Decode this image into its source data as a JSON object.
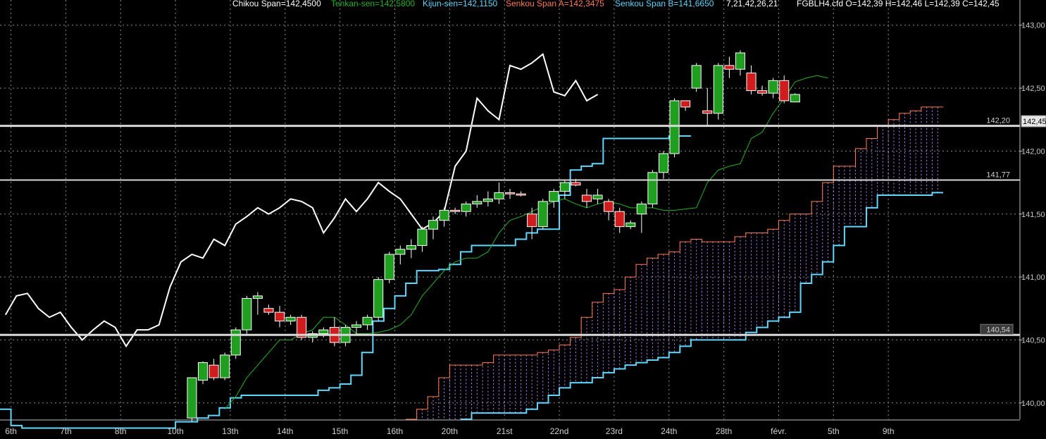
{
  "header": {
    "chikou": "Chikou Span=142,4500",
    "tenkan": "Tenkan-sen=142,5800",
    "kijun": "Kijun-sen=142,1150",
    "senkou_a": "Senkou Span A=142,3475",
    "senkou_b": "Senkou Span B=141,6650",
    "params": "7,21,42,26,21",
    "symbol_ohlc": "FGBLH4.cfd O=142,39 H=142,46 L=142,39 C=142,45"
  },
  "price_tag": "142,45",
  "colors": {
    "background": "#000000",
    "grid": "#8a8a8a",
    "up_candle": "#1f9e1f",
    "down_candle": "#d01c1c",
    "chikou": "#ffffff",
    "tenkan": "#22b422",
    "kijun": "#5fd7ff",
    "senkou_a": "#ff7a55",
    "senkou_b": "#5fd7ff",
    "cloud_fill": "#c080ff",
    "level_line": "#d8d8d8"
  },
  "chart_data": {
    "type": "candlestick",
    "instrument": "FGBLH4.cfd",
    "ylim": [
      139.87,
      143.2
    ],
    "yticks": [
      140.0,
      140.5,
      141.0,
      141.5,
      142.0,
      142.5,
      143.0
    ],
    "ytick_labels": [
      "140,00",
      "140,50",
      "141,00",
      "141,50",
      "142,00",
      "142,50",
      "143,00"
    ],
    "xlim": [
      0,
      93
    ],
    "x_labels": [
      {
        "x": 1,
        "label": "6th"
      },
      {
        "x": 6,
        "label": "7th"
      },
      {
        "x": 11,
        "label": "8th"
      },
      {
        "x": 16,
        "label": "10th"
      },
      {
        "x": 21,
        "label": "13th"
      },
      {
        "x": 26,
        "label": "14th"
      },
      {
        "x": 31,
        "label": "15th"
      },
      {
        "x": 36,
        "label": "16th"
      },
      {
        "x": 41,
        "label": "20th"
      },
      {
        "x": 46,
        "label": "21st"
      },
      {
        "x": 51,
        "label": "22nd"
      },
      {
        "x": 56,
        "label": "23rd"
      },
      {
        "x": 61,
        "label": "24th"
      },
      {
        "x": 66,
        "label": "28th"
      },
      {
        "x": 71,
        "label": "févr."
      },
      {
        "x": 76,
        "label": "5th"
      },
      {
        "x": 81,
        "label": "9th"
      }
    ],
    "levels": [
      {
        "value": 142.2,
        "label": "142,20"
      },
      {
        "value": 141.77,
        "label": "141,77"
      },
      {
        "value": 140.54,
        "label": "140,54"
      }
    ],
    "candles_start_x": 17,
    "candles": [
      [
        139.88,
        140.2,
        139.85,
        140.2
      ],
      [
        140.18,
        140.33,
        140.15,
        140.32
      ],
      [
        140.3,
        140.35,
        140.18,
        140.2
      ],
      [
        140.2,
        140.4,
        140.18,
        140.38
      ],
      [
        140.38,
        140.6,
        140.35,
        140.58
      ],
      [
        140.58,
        140.85,
        140.55,
        140.83
      ],
      [
        140.83,
        140.88,
        140.7,
        140.85
      ],
      [
        140.75,
        140.78,
        140.7,
        140.72
      ],
      [
        140.72,
        140.77,
        140.6,
        140.65
      ],
      [
        140.65,
        140.7,
        140.62,
        140.68
      ],
      [
        140.68,
        140.7,
        140.5,
        140.52
      ],
      [
        140.52,
        140.57,
        140.48,
        140.55
      ],
      [
        140.55,
        140.6,
        140.52,
        140.58
      ],
      [
        140.6,
        140.68,
        140.45,
        140.48
      ],
      [
        140.48,
        140.62,
        140.45,
        140.6
      ],
      [
        140.6,
        140.65,
        140.55,
        140.62
      ],
      [
        140.62,
        140.7,
        140.58,
        140.68
      ],
      [
        140.68,
        141.0,
        140.65,
        140.98
      ],
      [
        140.98,
        141.2,
        140.95,
        141.18
      ],
      [
        141.18,
        141.25,
        141.1,
        141.22
      ],
      [
        141.22,
        141.3,
        141.15,
        141.25
      ],
      [
        141.25,
        141.4,
        141.2,
        141.38
      ],
      [
        141.38,
        141.48,
        141.3,
        141.45
      ],
      [
        141.45,
        141.55,
        141.4,
        141.53
      ],
      [
        141.53,
        141.55,
        141.5,
        141.52
      ],
      [
        141.52,
        141.6,
        141.48,
        141.58
      ],
      [
        141.58,
        141.65,
        141.55,
        141.6
      ],
      [
        141.6,
        141.68,
        141.56,
        141.62
      ],
      [
        141.62,
        141.75,
        141.58,
        141.67
      ],
      [
        141.67,
        141.7,
        141.62,
        141.66
      ],
      [
        141.66,
        141.68,
        141.64,
        141.65
      ],
      [
        141.5,
        141.55,
        141.3,
        141.4
      ],
      [
        141.4,
        141.62,
        141.38,
        141.6
      ],
      [
        141.6,
        141.7,
        141.55,
        141.68
      ],
      [
        141.68,
        141.77,
        141.62,
        141.75
      ],
      [
        141.75,
        141.78,
        141.72,
        141.73
      ],
      [
        141.65,
        141.7,
        141.55,
        141.6
      ],
      [
        141.62,
        141.7,
        141.58,
        141.65
      ],
      [
        141.6,
        141.62,
        141.45,
        141.52
      ],
      [
        141.52,
        141.55,
        141.35,
        141.4
      ],
      [
        141.4,
        141.45,
        141.38,
        141.43
      ],
      [
        141.5,
        141.6,
        141.35,
        141.58
      ],
      [
        141.58,
        141.85,
        141.55,
        141.83
      ],
      [
        141.83,
        142.0,
        141.78,
        141.98
      ],
      [
        141.98,
        142.42,
        141.95,
        142.4
      ],
      [
        142.4,
        142.4,
        142.32,
        142.35
      ],
      [
        142.5,
        142.7,
        142.47,
        142.68
      ],
      [
        142.32,
        142.5,
        142.2,
        142.3
      ],
      [
        142.3,
        142.7,
        142.25,
        142.68
      ],
      [
        142.68,
        142.75,
        142.58,
        142.65
      ],
      [
        142.65,
        142.8,
        142.6,
        142.78
      ],
      [
        142.62,
        142.68,
        142.45,
        142.48
      ],
      [
        142.48,
        142.52,
        142.44,
        142.46
      ],
      [
        142.46,
        142.58,
        142.42,
        142.56
      ],
      [
        142.56,
        142.6,
        142.38,
        142.4
      ],
      [
        142.39,
        142.46,
        142.39,
        142.45
      ]
    ],
    "chikou_start_x": 0,
    "chikou": [
      140.7,
      140.85,
      140.87,
      140.75,
      140.68,
      140.72,
      140.6,
      140.5,
      140.58,
      140.65,
      140.6,
      140.45,
      140.58,
      140.58,
      140.62,
      140.92,
      141.12,
      141.18,
      141.15,
      141.3,
      141.25,
      141.42,
      141.48,
      141.55,
      141.5,
      141.55,
      141.62,
      141.6,
      141.55,
      141.35,
      141.47,
      141.62,
      141.52,
      141.62,
      141.75,
      141.68,
      141.62,
      141.5,
      141.38,
      141.43,
      141.52,
      141.88,
      142.0,
      142.42,
      142.32,
      142.25,
      142.68,
      142.65,
      142.7,
      142.77,
      142.47,
      142.44,
      142.56,
      142.4,
      142.45
    ],
    "tenkan_start_x": 20,
    "tenkan": [
      139.95,
      140.05,
      140.2,
      140.3,
      140.4,
      140.5,
      140.5,
      140.55,
      140.58,
      140.68,
      140.68,
      140.62,
      140.55,
      140.55,
      140.56,
      140.58,
      140.62,
      140.7,
      140.85,
      140.95,
      141.05,
      141.12,
      141.15,
      141.15,
      141.2,
      141.35,
      141.45,
      141.48,
      141.52,
      141.56,
      141.6,
      141.62,
      141.58,
      141.55,
      141.58,
      141.6,
      141.58,
      141.55,
      141.55,
      141.55,
      141.53,
      141.53,
      141.54,
      141.55,
      141.75,
      141.85,
      141.88,
      141.9,
      142.1,
      142.15,
      142.3,
      142.42,
      142.55,
      142.58,
      142.6,
      142.58
    ],
    "kijun_start_x": 0,
    "kijun": [
      139.95,
      139.82,
      139.8,
      139.8,
      139.8,
      139.8,
      139.8,
      139.8,
      139.8,
      139.8,
      139.8,
      139.8,
      139.8,
      139.8,
      139.8,
      139.8,
      139.85,
      139.85,
      139.88,
      139.9,
      139.96,
      140.04,
      140.06,
      140.06,
      140.06,
      140.06,
      140.06,
      140.06,
      140.06,
      140.1,
      140.12,
      140.15,
      140.22,
      140.4,
      140.65,
      140.75,
      140.85,
      140.95,
      141.05,
      141.05,
      141.06,
      141.1,
      141.2,
      141.25,
      141.25,
      141.25,
      141.25,
      141.3,
      141.35,
      141.38,
      141.38,
      141.65,
      141.85,
      141.88,
      141.9,
      142.1,
      142.1,
      142.1,
      142.1,
      142.1,
      142.1,
      142.12,
      142.12
    ],
    "senkou_a_start_x": 37,
    "senkou_a": [
      139.87,
      139.95,
      140.05,
      140.2,
      140.3,
      140.3,
      140.3,
      140.32,
      140.38,
      140.38,
      140.38,
      140.38,
      140.4,
      140.42,
      140.46,
      140.52,
      140.68,
      140.8,
      140.87,
      140.9,
      141.0,
      141.1,
      141.15,
      141.18,
      141.2,
      141.28,
      141.3,
      141.28,
      141.28,
      141.28,
      141.32,
      141.35,
      141.35,
      141.38,
      141.45,
      141.5,
      141.5,
      141.6,
      141.75,
      141.88,
      141.88,
      142.02,
      142.1,
      142.2,
      142.25,
      142.3,
      142.32,
      142.35,
      142.35
    ],
    "senkou_b_start_x": 42,
    "senkou_b": [
      139.87,
      139.92,
      139.92,
      139.92,
      139.92,
      139.92,
      139.95,
      140.0,
      140.06,
      140.12,
      140.16,
      140.16,
      140.2,
      140.24,
      140.27,
      140.3,
      140.32,
      140.34,
      140.36,
      140.4,
      140.45,
      140.5,
      140.5,
      140.5,
      140.5,
      140.5,
      140.56,
      140.6,
      140.65,
      140.68,
      140.72,
      140.95,
      141.02,
      141.12,
      141.25,
      141.4,
      141.4,
      141.55,
      141.65,
      141.65,
      141.65,
      141.65,
      141.65,
      141.67
    ]
  }
}
